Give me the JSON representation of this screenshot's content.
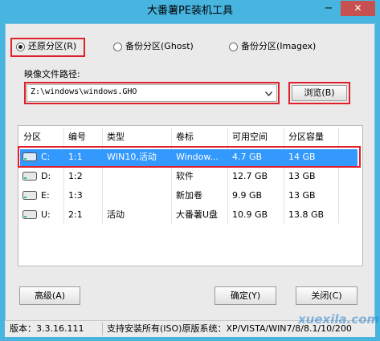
{
  "window": {
    "title": "大番薯PE装机工具",
    "minimize": "−",
    "close": "✕"
  },
  "modes": [
    {
      "label": "还原分区(R)",
      "selected": true
    },
    {
      "label": "备份分区(Ghost)",
      "selected": false
    },
    {
      "label": "备份分区(Imagex)",
      "selected": false
    }
  ],
  "image_path": {
    "label": "映像文件路径:",
    "value": "Z:\\windows\\windows.GHO",
    "browse_label": "浏览(B)"
  },
  "table": {
    "columns": [
      "分区",
      "编号",
      "类型",
      "卷标",
      "可用空间",
      "分区容量"
    ],
    "rows": [
      {
        "drive": "C:",
        "num": "1:1",
        "type": "WIN10,活动",
        "label": "Window...",
        "free": "4.7 GB",
        "size": "14 GB",
        "selected": true
      },
      {
        "drive": "D:",
        "num": "1:2",
        "type": "",
        "label": "软件",
        "free": "12.7 GB",
        "size": "13 GB",
        "selected": false
      },
      {
        "drive": "E:",
        "num": "1:3",
        "type": "",
        "label": "新加卷",
        "free": "9.9 GB",
        "size": "13 GB",
        "selected": false
      },
      {
        "drive": "U:",
        "num": "2:1",
        "type": "活动",
        "label": "大番薯U盘",
        "free": "10.9 GB",
        "size": "13.8 GB",
        "selected": false
      }
    ]
  },
  "buttons": {
    "advanced": "高级(A)",
    "ok": "确定(Y)",
    "close": "关闭(C)"
  },
  "status": {
    "version": "版本：3.3.16.111",
    "support": "支持安装所有(ISO)原版系统：XP/VISTA/WIN7/8/8.1/10/200"
  },
  "watermark": "xuexila.com",
  "colors": {
    "titlebar": "#48b5e0",
    "selection": "#3399ff",
    "highlight_box": "#e0202a"
  }
}
